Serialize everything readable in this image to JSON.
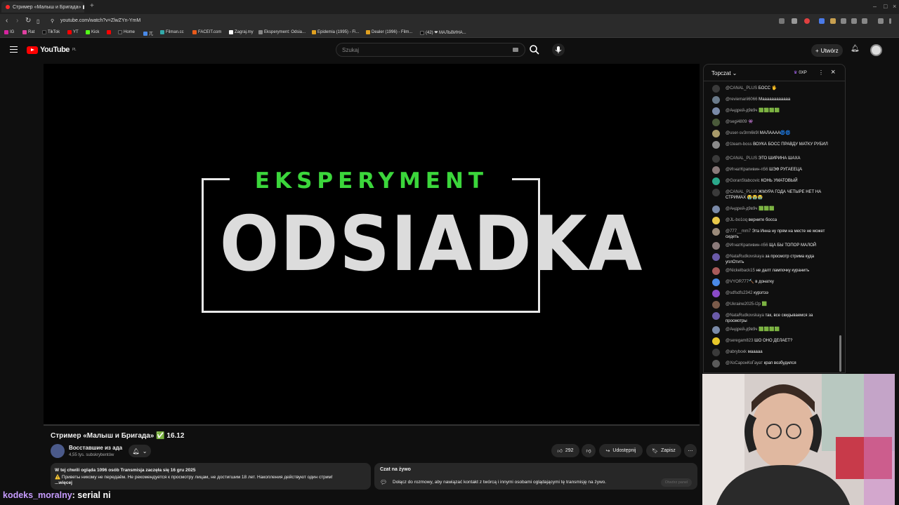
{
  "browser": {
    "tab_title": "Стример «Малыш и Бригада» ▮",
    "url": "youtube.com/watch?v=ZlwZYn-YmM",
    "bookmarks": [
      "IG",
      "Rat",
      "TikTok",
      "YT",
      "Kick",
      "Home",
      "兀",
      "Filman.cc",
      "FACEIT.com",
      "Zagraj.my",
      "Eksperyment: Odsia...",
      "Epidemia (1995) - Fi...",
      "Dealer (1996) - Film...",
      "(42) ❤ МАЛЬВИНА..."
    ]
  },
  "header": {
    "logo": "YouTube",
    "logo_region": "PL",
    "search_placeholder": "Szukaj",
    "create_label": "Utwórz"
  },
  "video": {
    "top_line": "EKSPERYMENT",
    "big_title": "ODSIADKA",
    "title": "Стример «Малыш и Бригада» ✅ 16.12",
    "channel": "Восставшие из ада",
    "subs": "4,55 tys. subskrybentów",
    "likes": "292",
    "share_label": "Udostępnij",
    "save_label": "Zapisz",
    "desc_line1": "W tej chwili ogląda 1096 osób  Transmisja zaczęła się 16 gru 2025",
    "desc_line2": "⚠️ Приветы никому не передаём. Не рекомендуется к просмотру лицам, не достигшим 18 лет. Накопления действуют один стрим!",
    "desc_more": "...więcej"
  },
  "live_chat_bar": {
    "title": "Czat na żywo",
    "text": "Dołącz do rozmowy, aby nawiązać kontakt z twórcą i innymi osobami oglądającymi tę transmisję na żywo.",
    "button": "Otwórz panel"
  },
  "chat": {
    "mode": "Topczat",
    "xp": "0XP",
    "messages": [
      {
        "author": "@CANAL_PLUS",
        "text": "БОСС 🖐",
        "color": "#3a3a3a"
      },
      {
        "author": "@reviemarii6066",
        "text": "Маааааааааааа",
        "color": "#6a7a8a"
      },
      {
        "author": "@Андрей-д9в9ч",
        "text": "🟩🟩🟩🟩",
        "color": "#7a8aa8"
      },
      {
        "author": "@segi4809",
        "text": "👾",
        "color": "#4a5a3a"
      },
      {
        "author": "@user-sv3rm6k9l",
        "text": "МАЛАААА🌀🌀",
        "color": "#a89a6a"
      },
      {
        "author": "@1team-boss",
        "text": "ВОУКА БОСС ПРАВДУ МАТКУ РУБИЛ",
        "color": "#8a8a8a"
      },
      {
        "author": "@CANAL_PLUS",
        "text": "ЭТО ШИРИНА ШАХА",
        "color": "#3a3a3a"
      },
      {
        "author": "@ИгнатКрапивин-п56",
        "text": "ШЭФ РУГАЕЕЦА",
        "color": "#8a7a7a"
      },
      {
        "author": "@GoranStabcovic",
        "text": "КОНЬ УМАТОВЫЙ",
        "color": "#2aa88a"
      },
      {
        "author": "@CANAL_PLUS",
        "text": "ЖМУРА ГОДА ЧЕТЫРЕ НЕТ НА СТРИМАХ 😭😭😭",
        "color": "#3a3a3a"
      },
      {
        "author": "@Андрей-д9в9ч",
        "text": "🟩🟩🟩",
        "color": "#7a8aa8"
      },
      {
        "author": "@JL-bo1oq",
        "text": "верните босса",
        "color": "#e8c84a"
      },
      {
        "author": "@777__mm7",
        "text": "Эта Инна ну прям на месте не может сидеть",
        "color": "#9a8a7a"
      },
      {
        "author": "@ИгнатКрапивин-п56",
        "text": "ЩА БЫ ТОПОР МАЛОЙ",
        "color": "#8a7a7a"
      },
      {
        "author": "@NataRudkovskaya",
        "text": "за просмотр стрима куда уплОтить",
        "color": "#6a5aa8"
      },
      {
        "author": "@Nickelback15",
        "text": "не далт лампочку куранить",
        "color": "#a85a5a"
      },
      {
        "author": "@VYOR777🔨",
        "text": "в донатку",
        "color": "#4a8ae8"
      },
      {
        "author": "@sdfsdfs2342",
        "text": "курэтээ",
        "color": "#8a4ac8"
      },
      {
        "author": "@Ukraine2025-l2p",
        "text": "🟩",
        "color": "#7a5a4a"
      },
      {
        "author": "@NataRudkovskaya",
        "text": "так, все скидываемся за просмотры",
        "color": "#6a5aa8"
      },
      {
        "author": "@Андрей-д9в9ч",
        "text": "🟩🟩🟩🟩",
        "color": "#7a8aa8"
      },
      {
        "author": "@seregam823",
        "text": "ШО ОНО ДЕЛАЕТ?",
        "color": "#e8c82a"
      },
      {
        "author": "@abryboкk",
        "text": "мааааа",
        "color": "#3a3a3a"
      },
      {
        "author": "@ХоСаронКоГауат",
        "text": "крап возбудился",
        "color": "#5a5a5a"
      }
    ]
  },
  "overlay_caption": {
    "user": "kodeks_moralny",
    "text": ": serial ni"
  }
}
